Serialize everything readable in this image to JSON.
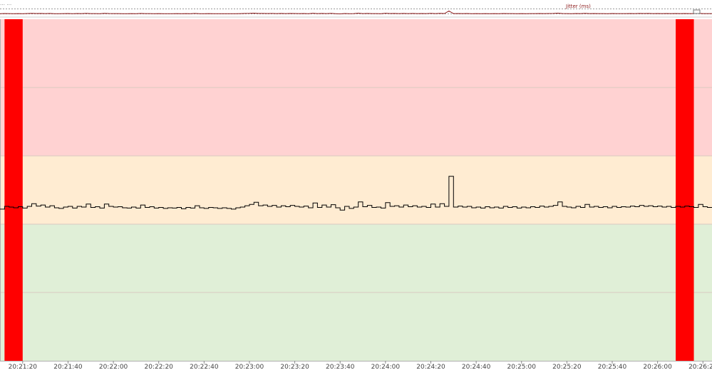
{
  "header": {
    "title_fragment": "… …",
    "legend_label": "Jitter (ms)"
  },
  "colors": {
    "band_high": "#ffd2d2",
    "band_mid": "#ffecd2",
    "band_low": "#e0efd7",
    "marker": "#ff0000",
    "trace": "#000000",
    "mini_trace": "#8b1a1a"
  },
  "chart_data": {
    "type": "line",
    "title": "",
    "xlabel": "",
    "ylabel": "",
    "x_range": [
      "20:21:10",
      "20:26:24"
    ],
    "y_range_relative": [
      0,
      1
    ],
    "grid": true,
    "x_ticks": [
      "20:21:20",
      "20:21:40",
      "20:22:00",
      "20:22:20",
      "20:22:40",
      "20:23:00",
      "20:23:20",
      "20:23:40",
      "20:24:00",
      "20:24:20",
      "20:24:40",
      "20:25:00",
      "20:25:20",
      "20:25:40",
      "20:26:00",
      "20:26:20"
    ],
    "bands": [
      {
        "name": "high",
        "from": 0.6,
        "to": 1.0,
        "color": "#ffd2d2"
      },
      {
        "name": "mid",
        "from": 0.4,
        "to": 0.6,
        "color": "#ffecd2"
      },
      {
        "name": "low",
        "from": 0.0,
        "to": 0.4,
        "color": "#e0efd7"
      }
    ],
    "markers": [
      {
        "from": "20:21:12",
        "to": "20:21:20"
      },
      {
        "from": "20:26:08",
        "to": "20:26:16"
      }
    ],
    "series": [
      {
        "step": true,
        "points": [
          [
            "20:21:10",
            0.444
          ],
          [
            "20:21:12",
            0.452
          ],
          [
            "20:21:14",
            0.45
          ],
          [
            "20:21:16",
            0.448
          ],
          [
            "20:21:18",
            0.451
          ],
          [
            "20:21:20",
            0.447
          ],
          [
            "20:21:22",
            0.452
          ],
          [
            "20:21:24",
            0.46
          ],
          [
            "20:21:26",
            0.453
          ],
          [
            "20:21:28",
            0.456
          ],
          [
            "20:21:30",
            0.45
          ],
          [
            "20:21:32",
            0.454
          ],
          [
            "20:21:34",
            0.448
          ],
          [
            "20:21:36",
            0.446
          ],
          [
            "20:21:38",
            0.45
          ],
          [
            "20:21:40",
            0.452
          ],
          [
            "20:21:42",
            0.447
          ],
          [
            "20:21:44",
            0.452
          ],
          [
            "20:21:46",
            0.45
          ],
          [
            "20:21:48",
            0.459
          ],
          [
            "20:21:50",
            0.449
          ],
          [
            "20:21:52",
            0.451
          ],
          [
            "20:21:54",
            0.447
          ],
          [
            "20:21:56",
            0.459
          ],
          [
            "20:21:58",
            0.452
          ],
          [
            "20:22:00",
            0.45
          ],
          [
            "20:22:02",
            0.451
          ],
          [
            "20:22:04",
            0.448
          ],
          [
            "20:22:06",
            0.447
          ],
          [
            "20:22:08",
            0.45
          ],
          [
            "20:22:10",
            0.447
          ],
          [
            "20:22:12",
            0.456
          ],
          [
            "20:22:14",
            0.449
          ],
          [
            "20:22:16",
            0.451
          ],
          [
            "20:22:18",
            0.447
          ],
          [
            "20:22:20",
            0.449
          ],
          [
            "20:22:22",
            0.446
          ],
          [
            "20:22:24",
            0.448
          ],
          [
            "20:22:26",
            0.447
          ],
          [
            "20:22:28",
            0.449
          ],
          [
            "20:22:30",
            0.445
          ],
          [
            "20:22:32",
            0.449
          ],
          [
            "20:22:34",
            0.447
          ],
          [
            "20:22:36",
            0.454
          ],
          [
            "20:22:38",
            0.448
          ],
          [
            "20:22:40",
            0.446
          ],
          [
            "20:22:42",
            0.449
          ],
          [
            "20:22:44",
            0.448
          ],
          [
            "20:22:46",
            0.446
          ],
          [
            "20:22:48",
            0.448
          ],
          [
            "20:22:50",
            0.446
          ],
          [
            "20:22:52",
            0.444
          ],
          [
            "20:22:54",
            0.448
          ],
          [
            "20:22:56",
            0.45
          ],
          [
            "20:22:58",
            0.454
          ],
          [
            "20:23:00",
            0.458
          ],
          [
            "20:23:02",
            0.464
          ],
          [
            "20:23:04",
            0.454
          ],
          [
            "20:23:06",
            0.456
          ],
          [
            "20:23:08",
            0.452
          ],
          [
            "20:23:10",
            0.455
          ],
          [
            "20:23:12",
            0.45
          ],
          [
            "20:23:14",
            0.454
          ],
          [
            "20:23:16",
            0.451
          ],
          [
            "20:23:18",
            0.455
          ],
          [
            "20:23:20",
            0.452
          ],
          [
            "20:23:22",
            0.45
          ],
          [
            "20:23:24",
            0.453
          ],
          [
            "20:23:26",
            0.448
          ],
          [
            "20:23:28",
            0.462
          ],
          [
            "20:23:30",
            0.449
          ],
          [
            "20:23:32",
            0.456
          ],
          [
            "20:23:34",
            0.45
          ],
          [
            "20:23:36",
            0.457
          ],
          [
            "20:23:38",
            0.448
          ],
          [
            "20:23:40",
            0.441
          ],
          [
            "20:23:42",
            0.452
          ],
          [
            "20:23:44",
            0.446
          ],
          [
            "20:23:46",
            0.45
          ],
          [
            "20:23:48",
            0.465
          ],
          [
            "20:23:50",
            0.451
          ],
          [
            "20:23:52",
            0.455
          ],
          [
            "20:23:54",
            0.449
          ],
          [
            "20:23:56",
            0.45
          ],
          [
            "20:23:58",
            0.447
          ],
          [
            "20:24:00",
            0.463
          ],
          [
            "20:24:02",
            0.452
          ],
          [
            "20:24:04",
            0.454
          ],
          [
            "20:24:06",
            0.45
          ],
          [
            "20:24:08",
            0.456
          ],
          [
            "20:24:10",
            0.451
          ],
          [
            "20:24:12",
            0.454
          ],
          [
            "20:24:14",
            0.45
          ],
          [
            "20:24:16",
            0.452
          ],
          [
            "20:24:18",
            0.449
          ],
          [
            "20:24:20",
            0.459
          ],
          [
            "20:24:22",
            0.45
          ],
          [
            "20:24:24",
            0.46
          ],
          [
            "20:24:26",
            0.452
          ],
          [
            "20:24:28",
            0.54
          ],
          [
            "20:24:30",
            0.45
          ],
          [
            "20:24:32",
            0.453
          ],
          [
            "20:24:34",
            0.45
          ],
          [
            "20:24:36",
            0.452
          ],
          [
            "20:24:38",
            0.448
          ],
          [
            "20:24:40",
            0.45
          ],
          [
            "20:24:42",
            0.447
          ],
          [
            "20:24:44",
            0.451
          ],
          [
            "20:24:46",
            0.448
          ],
          [
            "20:24:48",
            0.45
          ],
          [
            "20:24:50",
            0.447
          ],
          [
            "20:24:52",
            0.452
          ],
          [
            "20:24:54",
            0.449
          ],
          [
            "20:24:56",
            0.451
          ],
          [
            "20:24:58",
            0.447
          ],
          [
            "20:25:00",
            0.45
          ],
          [
            "20:25:02",
            0.448
          ],
          [
            "20:25:04",
            0.451
          ],
          [
            "20:25:06",
            0.449
          ],
          [
            "20:25:08",
            0.453
          ],
          [
            "20:25:10",
            0.45
          ],
          [
            "20:25:12",
            0.452
          ],
          [
            "20:25:14",
            0.455
          ],
          [
            "20:25:16",
            0.465
          ],
          [
            "20:25:18",
            0.452
          ],
          [
            "20:25:20",
            0.45
          ],
          [
            "20:25:22",
            0.448
          ],
          [
            "20:25:24",
            0.452
          ],
          [
            "20:25:26",
            0.449
          ],
          [
            "20:25:28",
            0.458
          ],
          [
            "20:25:30",
            0.45
          ],
          [
            "20:25:32",
            0.452
          ],
          [
            "20:25:34",
            0.449
          ],
          [
            "20:25:36",
            0.451
          ],
          [
            "20:25:38",
            0.448
          ],
          [
            "20:25:40",
            0.452
          ],
          [
            "20:25:42",
            0.449
          ],
          [
            "20:25:44",
            0.451
          ],
          [
            "20:25:46",
            0.45
          ],
          [
            "20:25:48",
            0.453
          ],
          [
            "20:25:50",
            0.451
          ],
          [
            "20:25:52",
            0.455
          ],
          [
            "20:25:54",
            0.452
          ],
          [
            "20:25:56",
            0.454
          ],
          [
            "20:25:58",
            0.451
          ],
          [
            "20:26:00",
            0.453
          ],
          [
            "20:26:02",
            0.45
          ],
          [
            "20:26:04",
            0.452
          ],
          [
            "20:26:06",
            0.449
          ],
          [
            "20:26:08",
            0.452
          ],
          [
            "20:26:10",
            0.45
          ],
          [
            "20:26:12",
            0.453
          ],
          [
            "20:26:14",
            0.451
          ],
          [
            "20:26:16",
            0.449
          ],
          [
            "20:26:18",
            0.458
          ],
          [
            "20:26:20",
            0.451
          ],
          [
            "20:26:22",
            0.449
          ],
          [
            "20:26:24",
            0.45
          ]
        ]
      }
    ]
  }
}
